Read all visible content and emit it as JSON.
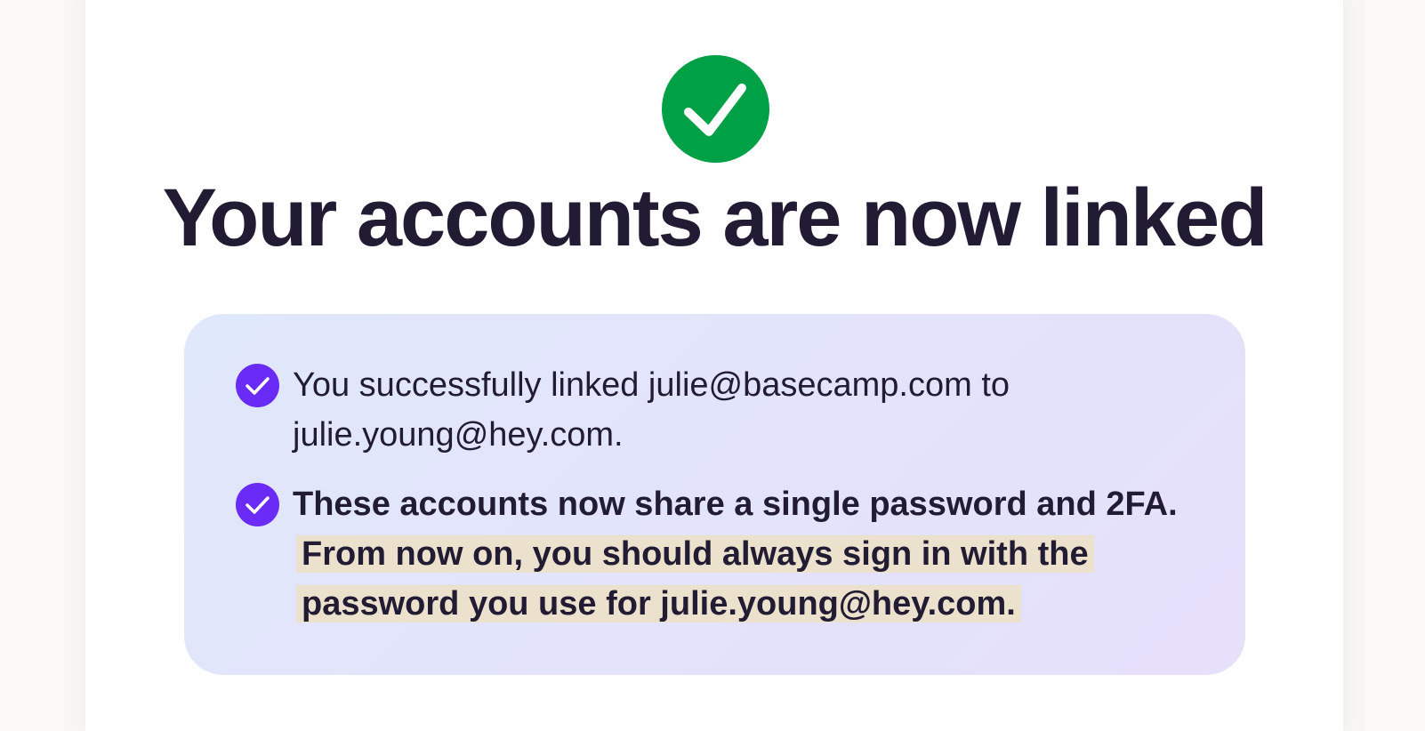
{
  "header": {
    "icon": "check-circle-icon",
    "title": "Your accounts are now linked"
  },
  "info": {
    "items": [
      {
        "icon": "check-badge-icon",
        "text": "You successfully linked julie@basecamp.com to julie.young@hey.com."
      },
      {
        "icon": "check-badge-icon",
        "text": "These accounts now share a single password and 2FA.",
        "highlight": "From now on, you should always sign in with the password you use for julie.young@hey.com."
      }
    ]
  },
  "colors": {
    "success": "#00a046",
    "accent": "#6a2bf6",
    "text": "#211c33",
    "highlight": "#ece1cc"
  }
}
